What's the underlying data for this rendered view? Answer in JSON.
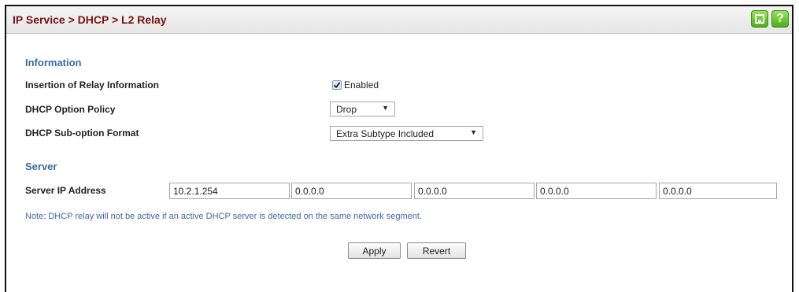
{
  "page": {
    "breadcrumb": "IP Service > DHCP > L2 Relay"
  },
  "toolbar": {
    "save_icon": "save-icon",
    "help_icon": "help-icon",
    "help_glyph": "?"
  },
  "information": {
    "heading": "Information",
    "insertion_label": "Insertion of Relay Information",
    "insertion_checked": true,
    "insertion_value_label": "Enabled",
    "option_policy_label": "DHCP Option Policy",
    "option_policy_value": "Drop",
    "suboption_label": "DHCP Sub-option Format",
    "suboption_value": "Extra Subtype Included"
  },
  "server": {
    "heading": "Server",
    "ip_label": "Server IP Address",
    "ips": [
      "10.2.1.254",
      "0.0.0.0",
      "0.0.0.0",
      "0.0.0.0",
      "0.0.0.0"
    ]
  },
  "note": "Note: DHCP relay will not be active if an active DHCP server is detected on the same network segment.",
  "buttons": {
    "apply": "Apply",
    "revert": "Revert"
  },
  "colors": {
    "title": "#7a1010",
    "section": "#3d6aa6",
    "icon_green": "#4fae1c"
  }
}
